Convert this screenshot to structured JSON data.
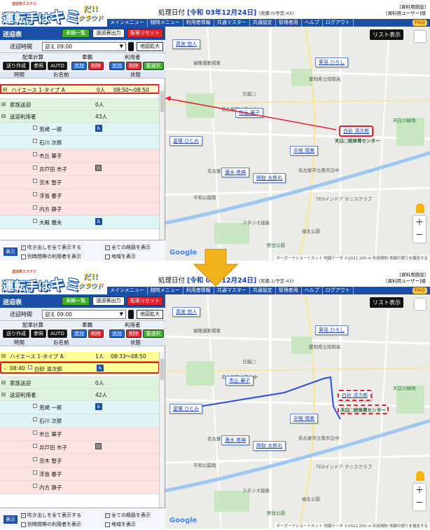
{
  "app": {
    "logo_tag": "送迎表ミステリ",
    "logo_main_a": "運転手は",
    "logo_main_b": "キミ",
    "logo_main_c": "だ!!",
    "logo_cloud": "クラウド",
    "process_label": "処理日付",
    "facility": "[資料用施設]",
    "user": "[資料用ユーザー]様",
    "menu": [
      "メインメニュー",
      "随時メニュー",
      "利用者情報",
      "共通マスター",
      "共通設定",
      "管理者用",
      "ヘルプ",
      "ログアウト"
    ],
    "faq": "FAQ",
    "colors": {
      "brand_blue": "#1c4fa8",
      "accent_red": "#e0232a",
      "accent_green": "#3fae2a"
    }
  },
  "before": {
    "date": "[令和 03年12月24日]",
    "stats": "(実績:0/予定:43)",
    "vehicle": {
      "name": "ハイエース 1-タイプ A",
      "count": "0人",
      "time": "08:50～08:50"
    },
    "groups": [
      {
        "name": "家族送迎",
        "count": "0人"
      },
      {
        "name": "送迎利用者",
        "count": "43人"
      }
    ],
    "persons": [
      {
        "name": "荒崎 一郎",
        "icon": "wheelchair-icon",
        "color": "#dff4f4"
      },
      {
        "name": "石川 次郎",
        "icon": "",
        "color": "#dff4f4"
      },
      {
        "name": "市丘 華子",
        "icon": "",
        "color": "#ffe3e3"
      },
      {
        "name": "井戸田 市子",
        "icon": "bed-icon",
        "color": "#ffe3e3"
      },
      {
        "name": "茨木 智子",
        "icon": "",
        "color": "#ffe3e3"
      },
      {
        "name": "浮島 春子",
        "icon": "",
        "color": "#ffe3e3"
      },
      {
        "name": "内方 静子",
        "icon": "",
        "color": "#ffe3e3"
      },
      {
        "name": "大殿 雅夫",
        "icon": "wheelchair-icon",
        "color": "#dff4f4"
      }
    ]
  },
  "after": {
    "date": "[令和 03年12月24日]",
    "stats": "(実績:1/予定:43)",
    "vehicle": {
      "name": "ハイエース 1-タイプ A",
      "count": "1人",
      "time": "08:33～08:50"
    },
    "assigned": {
      "time": "08:40",
      "name": "白砂 清次郎"
    },
    "groups": [
      {
        "name": "家族送迎",
        "count": "0人"
      },
      {
        "name": "送迎利用者",
        "count": "42人"
      }
    ],
    "persons": [
      {
        "name": "荒崎 一郎",
        "icon": "wheelchair-icon",
        "color": "#dff4f4"
      },
      {
        "name": "石川 次郎",
        "icon": "",
        "color": "#dff4f4"
      },
      {
        "name": "市丘 華子",
        "icon": "",
        "color": "#ffe3e3"
      },
      {
        "name": "井戸田 市子",
        "icon": "bed-icon",
        "color": "#ffe3e3"
      },
      {
        "name": "茨木 智子",
        "icon": "",
        "color": "#ffe3e3"
      },
      {
        "name": "浮島 春子",
        "icon": "",
        "color": "#ffe3e3"
      },
      {
        "name": "内方 静子",
        "icon": "",
        "color": "#ffe3e3"
      }
    ]
  },
  "panel": {
    "title": "送迎表",
    "btn_vehicles": "車輌一覧",
    "btn_print": "送迎表出力",
    "btn_reset": "配車リセット",
    "time_label": "送迎時間",
    "time_value": "迎え 09:00",
    "zoom_btn": "地図拡大",
    "col_calc": "配車計算",
    "col_vehicle": "車輌",
    "col_user": "利用者",
    "btn_create": "送り作成",
    "btn_ref": "参照",
    "btn_auto": "AUTO",
    "btn_add": "追加",
    "btn_del": "削除",
    "btn_add2": "追加",
    "btn_del2": "削除",
    "btn_select": "要選択",
    "h_time": "時間",
    "h_name": "お名前",
    "h_status": "状態",
    "footer_show": "表示",
    "cb_balloon": "吹き出しを全て表示する",
    "cb_all_routes": "全ての経路を表示",
    "cb_other": "別時間帯の利用者を表示",
    "cb_area": "地域を表示",
    "list_btn": "リスト表示"
  },
  "map": {
    "pins": [
      {
        "label": "真宮 悠人"
      },
      {
        "label": "葵見 ひろし"
      },
      {
        "label": "市丘 華子"
      },
      {
        "label": "白砂 清次郎"
      },
      {
        "label": "釜塚 ひとみ"
      },
      {
        "label": "中根 晴美"
      },
      {
        "label": "蓮水 希典"
      },
      {
        "label": "関取 太郎丸"
      }
    ],
    "center_label": "天白□校体育センター",
    "places": [
      "瑞穂運動場東",
      "日進□",
      "愛知県立昭和高",
      "名古屋市立萩山中",
      "名古屋市立汐路小",
      "名古屋市立南天白中",
      "平和公園南",
      "TEGインドア テニスクラブ",
      "野並公園",
      "福生公園",
      "天白川緑地",
      "スタジオ越後"
    ],
    "attribution": "キーボードショートカット 地図データ ©2021 200 m 利用規約 地図の誤りを報告する",
    "google": "Google"
  }
}
